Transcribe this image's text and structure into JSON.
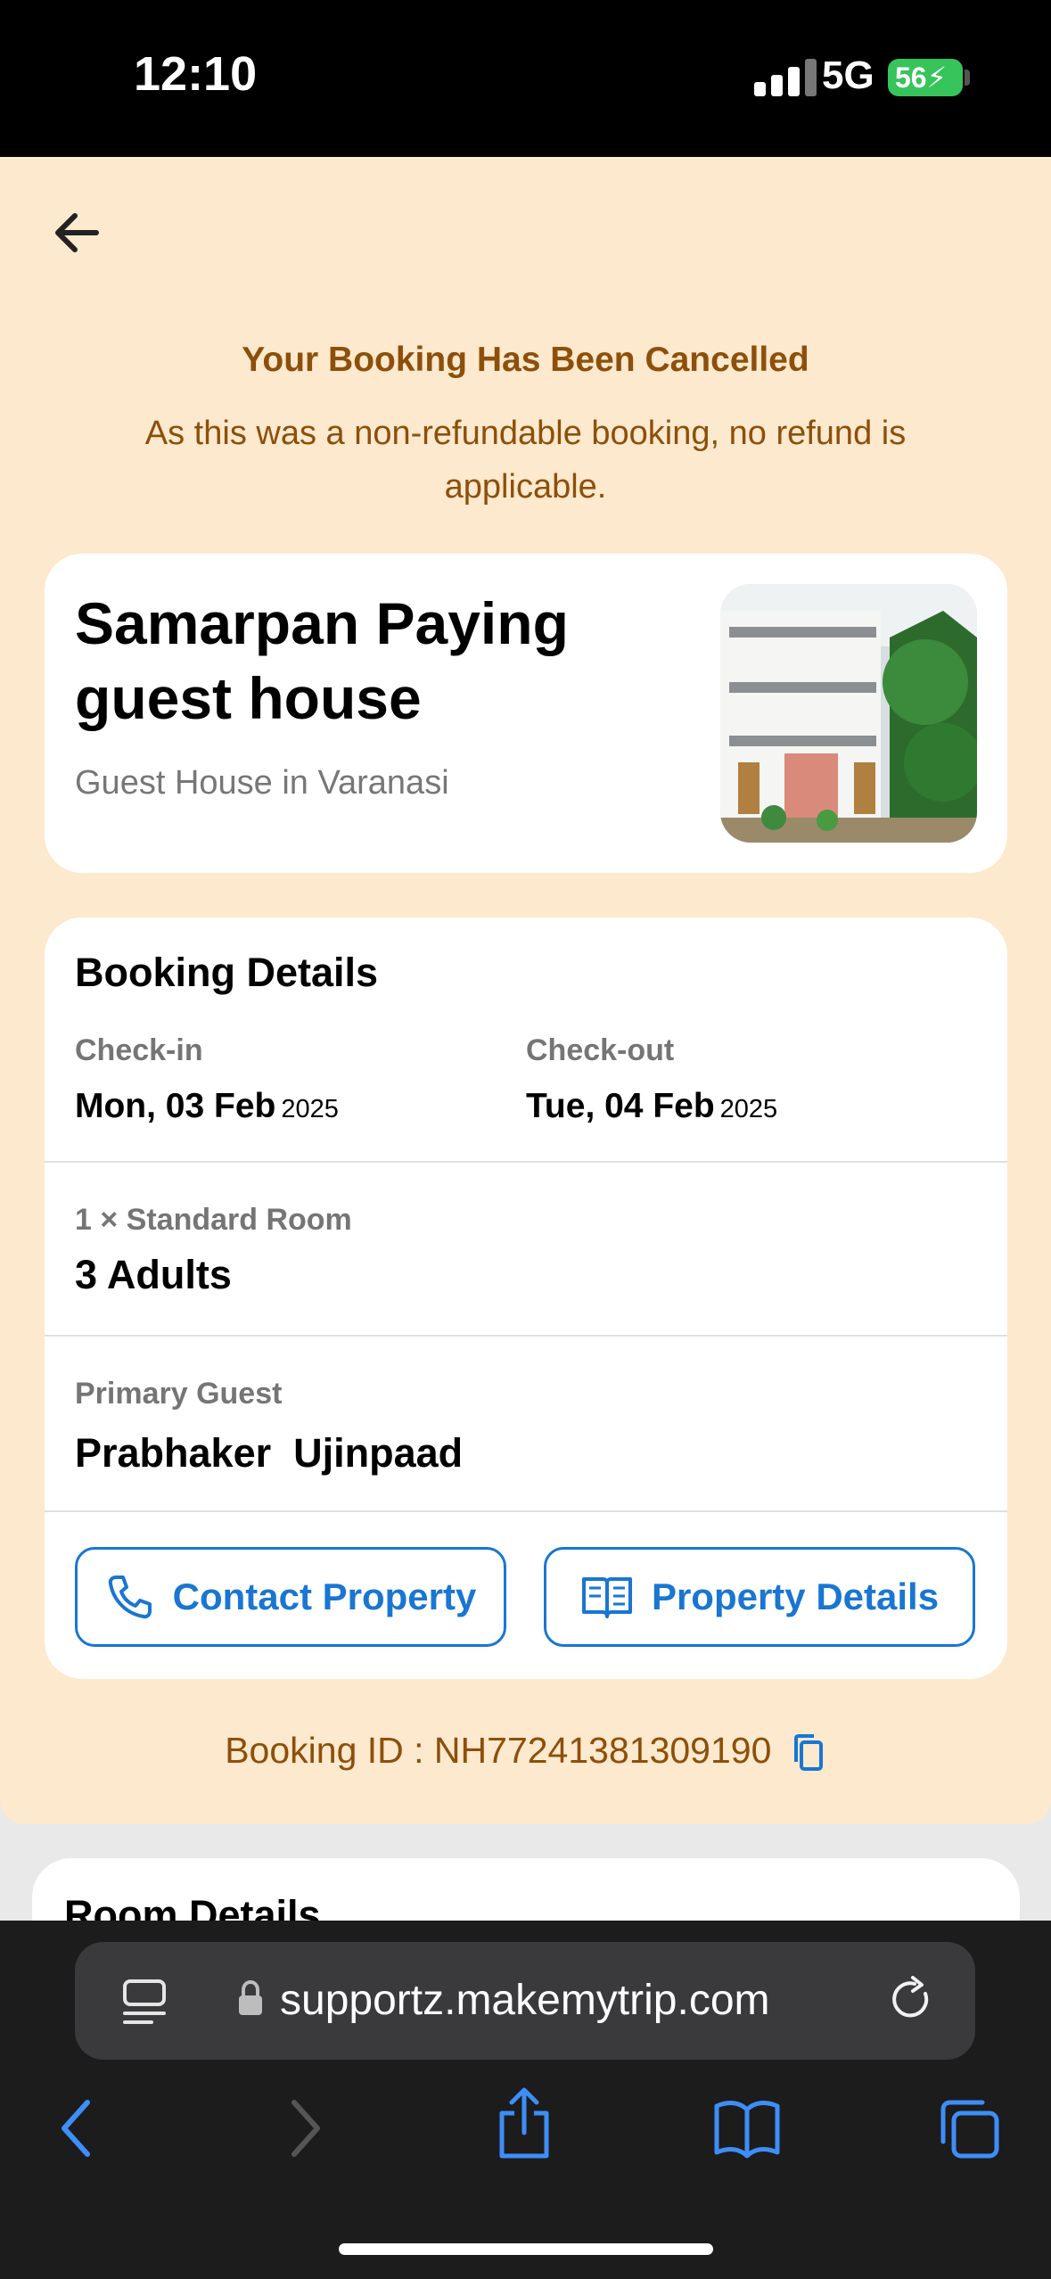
{
  "status_bar": {
    "time": "12:10",
    "network": "5G",
    "battery": "56"
  },
  "notice": {
    "title": "Your Booking Has Been Cancelled",
    "message": "As this was a non-refundable booking, no refund is applicable."
  },
  "property": {
    "name": "Samarpan Paying guest house",
    "type": "Guest House in Varanasi"
  },
  "booking_details": {
    "title": "Booking Details",
    "checkin_label": "Check-in",
    "checkin_date": "Mon, 03 Feb",
    "checkin_year": "2025",
    "checkout_label": "Check-out",
    "checkout_date": "Tue, 04 Feb",
    "checkout_year": "2025",
    "room_label": "1 × Standard Room",
    "guests": "3 Adults",
    "primary_guest_label": "Primary Guest",
    "primary_guest_name": "Prabhaker  Ujinpaad",
    "contact_button": "Contact Property",
    "details_button": "Property Details"
  },
  "booking_id": "Booking ID : NH77241381309190",
  "room_details_title": "Room Details",
  "browser": {
    "url": "supportz.makemytrip.com"
  },
  "colors": {
    "accent": "#1976d2",
    "notice_text": "#8d4f0a",
    "page_bg": "#fde9ce"
  }
}
